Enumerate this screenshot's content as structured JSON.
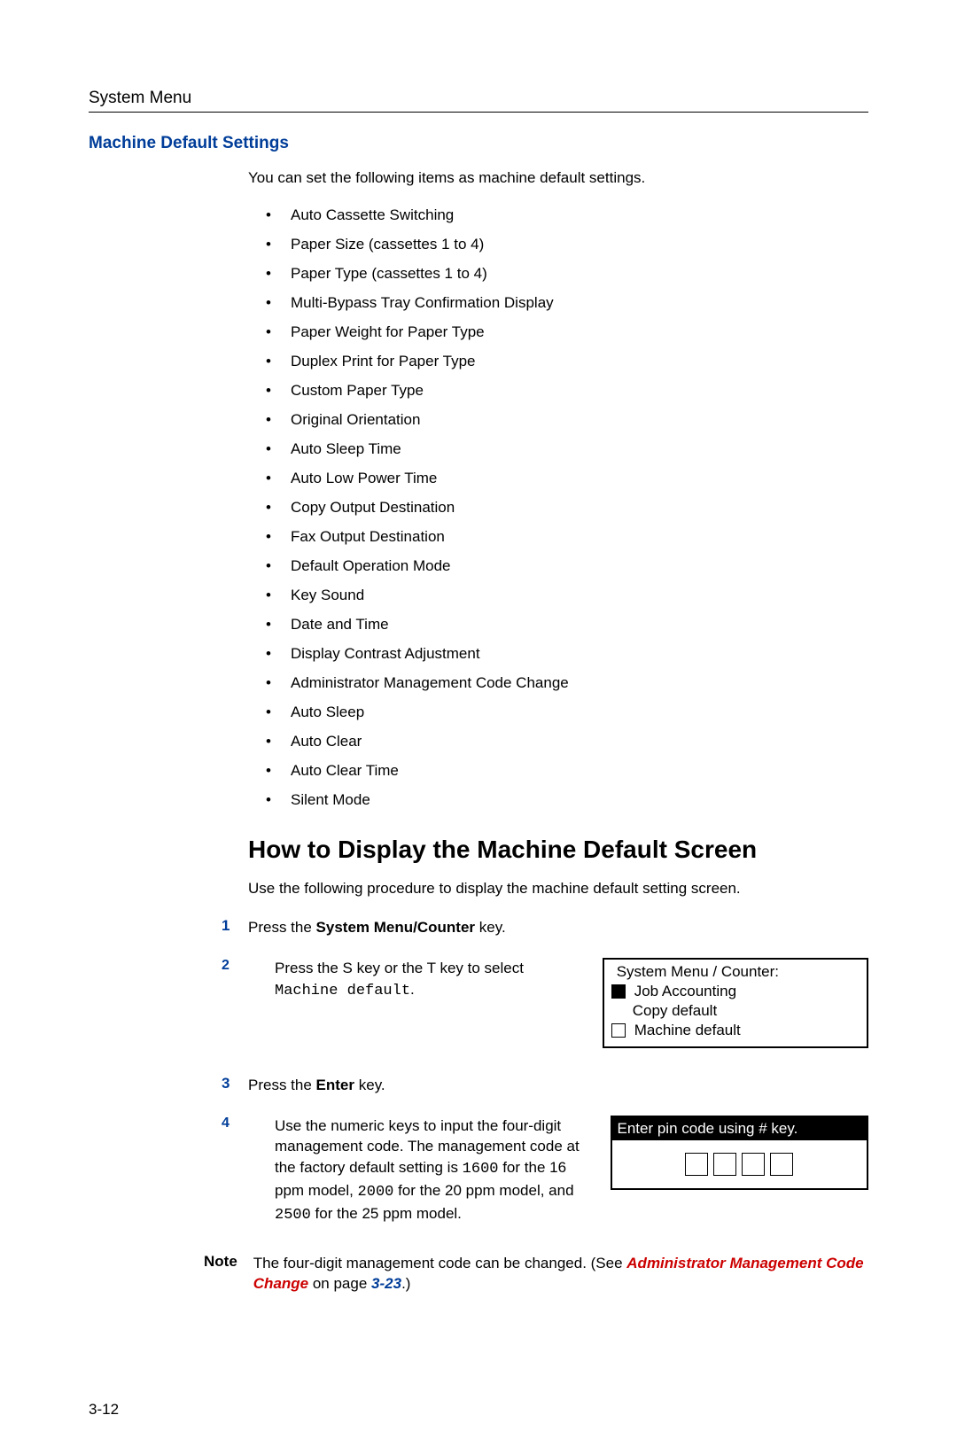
{
  "header": {
    "breadcrumb": "System Menu"
  },
  "section": {
    "title": "Machine Default Settings",
    "intro": "You can set the following items as machine default settings."
  },
  "bullets": [
    "Auto Cassette Switching",
    "Paper Size (cassettes 1 to 4)",
    "Paper Type (cassettes 1 to 4)",
    "Multi-Bypass Tray Confirmation Display",
    "Paper Weight for Paper Type",
    "Duplex Print for Paper Type",
    "Custom Paper Type",
    "Original Orientation",
    "Auto Sleep Time",
    "Auto Low Power Time",
    "Copy Output Destination",
    "Fax Output Destination",
    "Default Operation Mode",
    "Key Sound",
    "Date and Time",
    "Display Contrast Adjustment",
    "Administrator Management Code Change",
    "Auto Sleep",
    "Auto Clear",
    "Auto Clear Time",
    "Silent Mode"
  ],
  "h2": "How to Display the Machine Default Screen",
  "proc_intro": "Use the following procedure to display the machine default setting screen.",
  "steps": {
    "s1": {
      "num": "1",
      "prefix": "Press the ",
      "bold": "System Menu/Counter",
      "suffix": " key."
    },
    "s2": {
      "num": "2",
      "text_a": "Press the S key or the T key to select ",
      "mono": "Machine default",
      "text_b": "."
    },
    "s3": {
      "num": "3",
      "prefix": "Press the ",
      "bold": "Enter",
      "suffix": " key."
    },
    "s4": {
      "num": "4",
      "text_a": "Use the numeric keys to input the four-digit management code. The management code at the factory default setting is ",
      "m1": "1600",
      "text_b": " for the 16 ppm model, ",
      "m2": "2000",
      "text_c": " for the 20 ppm model, and ",
      "m3": "2500",
      "text_d": " for the 25 ppm model."
    }
  },
  "lcd": {
    "title": "System Menu / Counter:",
    "rows": [
      "Job Accounting",
      "Copy default",
      "Machine default"
    ]
  },
  "pin": {
    "header": "Enter pin code using # key."
  },
  "note": {
    "label": "Note",
    "text_a": "The four-digit management code can be changed. (See ",
    "link": "Administrator Management Code Change",
    "text_b": " on page ",
    "pageref": "3-23",
    "text_c": ".)"
  },
  "page_number": "3-12"
}
